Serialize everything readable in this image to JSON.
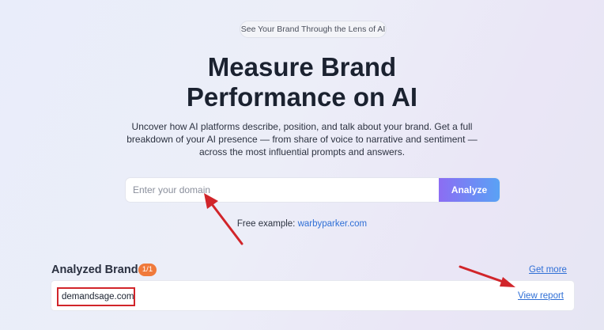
{
  "hero": {
    "pill": "See Your Brand Through the Lens of AI",
    "title_line1": "Measure Brand",
    "title_line2": "Performance on AI",
    "subtitle": "Uncover how AI platforms describe, position, and talk about your brand. Get a full breakdown of your AI presence — from share of voice to narrative and sentiment — across the most influential prompts and answers."
  },
  "search": {
    "placeholder": "Enter your domain",
    "value": "",
    "button_label": "Analyze"
  },
  "free_example": {
    "prefix": "Free example:",
    "link": "warbyparker.com"
  },
  "analyzed": {
    "title": "Analyzed Brands",
    "count_badge": "1/1",
    "get_more": "Get more",
    "brands": [
      {
        "domain": "demandsage.com",
        "action": "View report"
      }
    ]
  },
  "colors": {
    "accent_blue": "#2f6fd6",
    "badge_orange": "#f07a3b",
    "annotation_red": "#d1252a",
    "button_gradient_start": "#8c6df3",
    "button_gradient_end": "#5aa2f5"
  }
}
